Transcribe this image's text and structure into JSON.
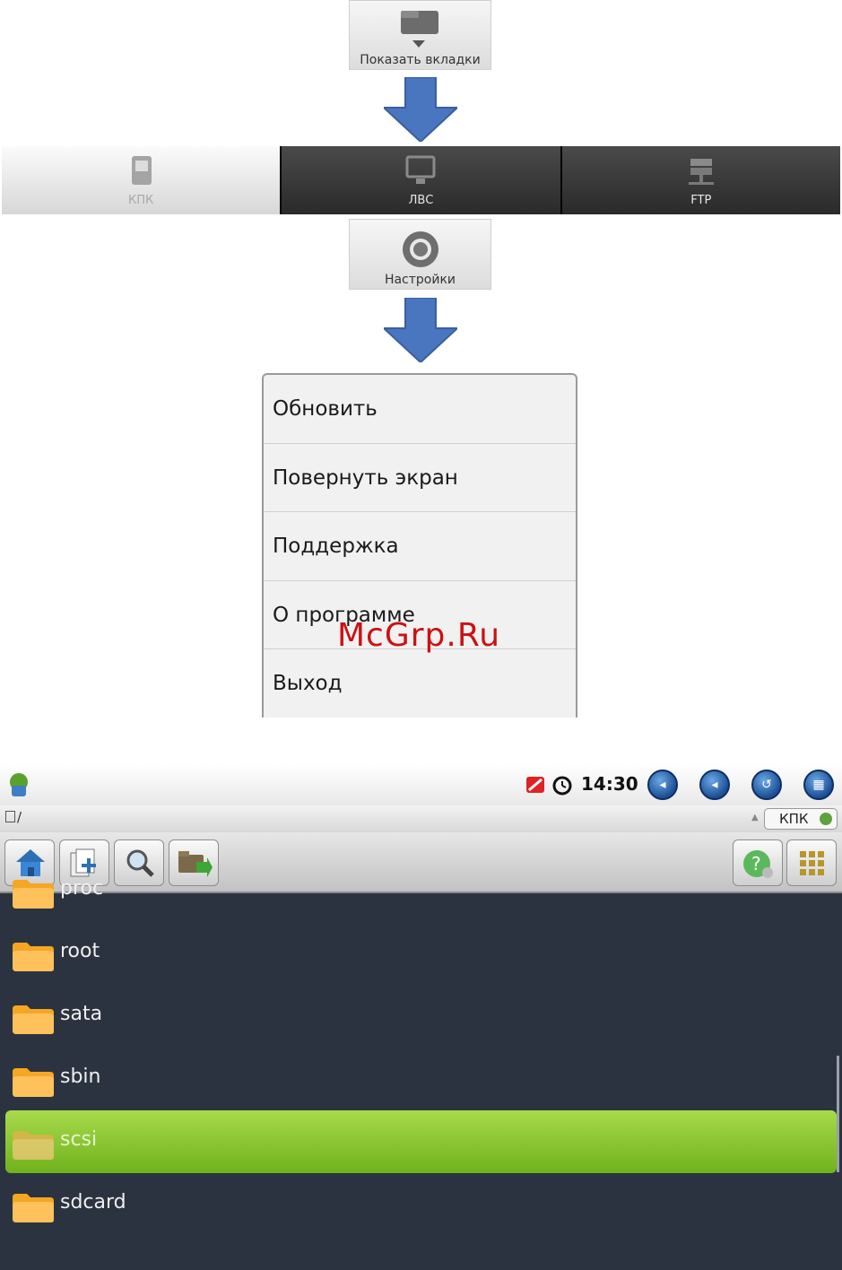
{
  "show_tabs": {
    "label": "Показать вкладки"
  },
  "tabs": [
    {
      "label": "КПК",
      "active": true,
      "icon": "pda-icon"
    },
    {
      "label": "ЛВС",
      "active": false,
      "icon": "monitor-icon"
    },
    {
      "label": "FTP",
      "active": false,
      "icon": "ftp-server-icon"
    }
  ],
  "settings": {
    "label": "Настройки"
  },
  "menu": {
    "items": [
      "Обновить",
      "Повернуть экран",
      "Поддержка",
      "О программе",
      "Выход"
    ]
  },
  "watermark": "McGrp.Ru",
  "device": {
    "status": {
      "time": "14:30"
    },
    "path": "/",
    "location_selector": "КПК",
    "toolbar": [
      "home-icon",
      "new-folder-icon",
      "search-icon",
      "move-icon",
      "help-icon",
      "grid-icon"
    ],
    "folders": [
      {
        "name": "proc",
        "selected": false
      },
      {
        "name": "root",
        "selected": false
      },
      {
        "name": "sata",
        "selected": false
      },
      {
        "name": "sbin",
        "selected": false
      },
      {
        "name": "scsi",
        "selected": true
      },
      {
        "name": "sdcard",
        "selected": false
      }
    ],
    "colors": {
      "selection": "#8cc63f",
      "list_bg": "#2b3340"
    }
  }
}
